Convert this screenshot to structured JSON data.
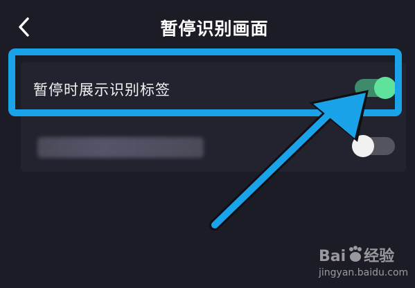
{
  "header": {
    "title": "暂停识别画面",
    "back_icon": "chevron-left-icon"
  },
  "settings": {
    "items": [
      {
        "label": "暂停时展示识别标签",
        "toggle_on": true
      },
      {
        "label": "",
        "toggle_on": false
      }
    ]
  },
  "annotation": {
    "highlight_color": "#1aa3e8",
    "arrow_color": "#1aa3e8"
  },
  "colors": {
    "background": "#1c1c26",
    "toggle_on": "#5fe39c",
    "toggle_off": "#f1f1f1"
  },
  "watermark": {
    "brand_left": "Bai",
    "brand_right": "经验",
    "url": "jingyan.baidu.com"
  }
}
